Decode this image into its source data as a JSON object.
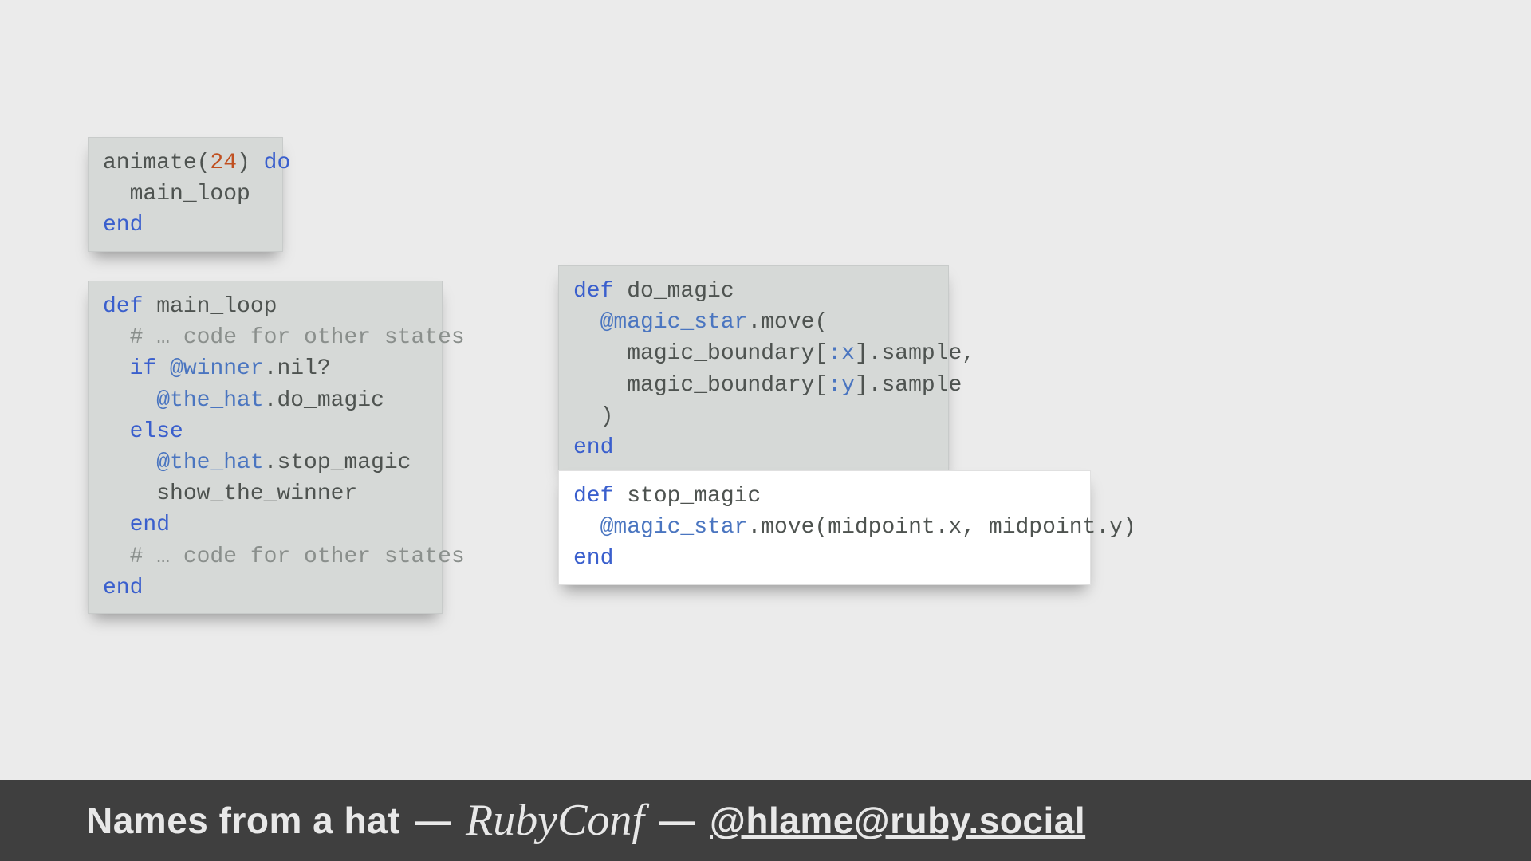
{
  "boxes": {
    "animate": {
      "lines": [
        [
          {
            "cls": "plain",
            "t": "animate("
          },
          {
            "cls": "num",
            "t": "24"
          },
          {
            "cls": "plain",
            "t": ") "
          },
          {
            "cls": "kw",
            "t": "do"
          }
        ],
        [
          {
            "cls": "plain",
            "t": "  main_loop"
          }
        ],
        [
          {
            "cls": "kw",
            "t": "end"
          }
        ]
      ]
    },
    "mainloop": {
      "lines": [
        [
          {
            "cls": "kw",
            "t": "def"
          },
          {
            "cls": "plain",
            "t": " main_loop"
          }
        ],
        [
          {
            "cls": "plain",
            "t": "  "
          },
          {
            "cls": "com",
            "t": "# … code for other states"
          }
        ],
        [
          {
            "cls": "plain",
            "t": "  "
          },
          {
            "cls": "kw",
            "t": "if"
          },
          {
            "cls": "plain",
            "t": " "
          },
          {
            "cls": "ivar",
            "t": "@winner"
          },
          {
            "cls": "plain",
            "t": ".nil?"
          }
        ],
        [
          {
            "cls": "plain",
            "t": "    "
          },
          {
            "cls": "ivar",
            "t": "@the_hat"
          },
          {
            "cls": "plain",
            "t": ".do_magic"
          }
        ],
        [
          {
            "cls": "plain",
            "t": "  "
          },
          {
            "cls": "kw",
            "t": "else"
          }
        ],
        [
          {
            "cls": "plain",
            "t": "    "
          },
          {
            "cls": "ivar",
            "t": "@the_hat"
          },
          {
            "cls": "plain",
            "t": ".stop_magic"
          }
        ],
        [
          {
            "cls": "plain",
            "t": "    show_the_winner"
          }
        ],
        [
          {
            "cls": "plain",
            "t": "  "
          },
          {
            "cls": "kw",
            "t": "end"
          }
        ],
        [
          {
            "cls": "plain",
            "t": "  "
          },
          {
            "cls": "com",
            "t": "# … code for other states"
          }
        ],
        [
          {
            "cls": "kw",
            "t": "end"
          }
        ]
      ]
    },
    "domagic": {
      "lines": [
        [
          {
            "cls": "kw",
            "t": "def"
          },
          {
            "cls": "plain",
            "t": " do_magic"
          }
        ],
        [
          {
            "cls": "plain",
            "t": "  "
          },
          {
            "cls": "ivar",
            "t": "@magic_star"
          },
          {
            "cls": "plain",
            "t": ".move("
          }
        ],
        [
          {
            "cls": "plain",
            "t": "    magic_boundary["
          },
          {
            "cls": "sym",
            "t": ":x"
          },
          {
            "cls": "plain",
            "t": "].sample,"
          }
        ],
        [
          {
            "cls": "plain",
            "t": "    magic_boundary["
          },
          {
            "cls": "sym",
            "t": ":y"
          },
          {
            "cls": "plain",
            "t": "].sample"
          }
        ],
        [
          {
            "cls": "plain",
            "t": "  )"
          }
        ],
        [
          {
            "cls": "kw",
            "t": "end"
          }
        ]
      ]
    },
    "stopmagic": {
      "lines": [
        [
          {
            "cls": "kw",
            "t": "def"
          },
          {
            "cls": "plain",
            "t": " stop_magic"
          }
        ],
        [
          {
            "cls": "plain",
            "t": "  "
          },
          {
            "cls": "ivar",
            "t": "@magic_star"
          },
          {
            "cls": "plain",
            "t": ".move(midpoint.x, midpoint.y)"
          }
        ],
        [
          {
            "cls": "kw",
            "t": "end"
          }
        ]
      ]
    }
  },
  "footer": {
    "title": "Names from a hat",
    "dash": "—",
    "logo": "RubyConf",
    "handle": "@hlame@ruby.social"
  }
}
